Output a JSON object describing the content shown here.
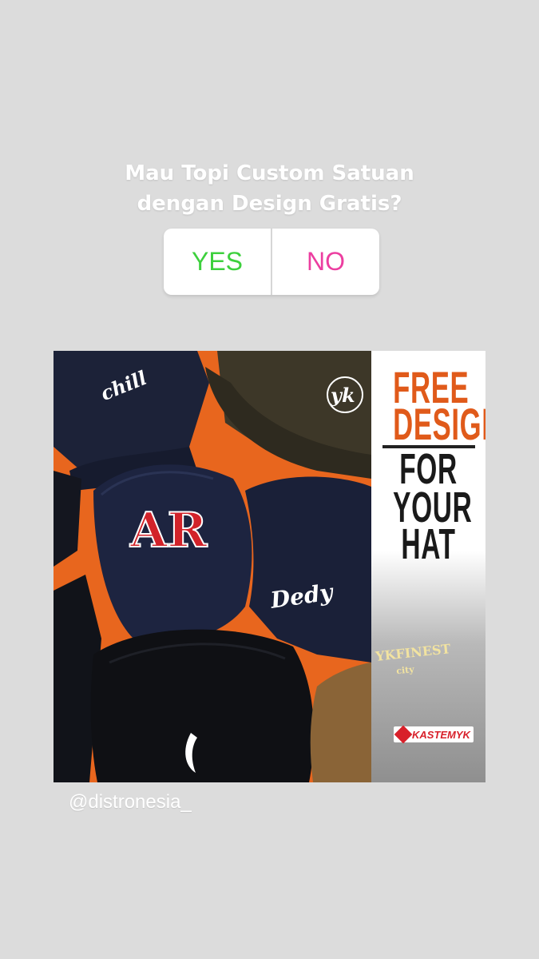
{
  "poll": {
    "question_line1": "Mau Topi Custom Satuan",
    "question_line2": "dengan Design Gratis?",
    "option_yes": "YES",
    "option_no": "NO",
    "colors": {
      "yes": "#3dd03d",
      "no": "#ec3ea0"
    }
  },
  "post": {
    "embroidery": {
      "hat1": "chill",
      "hat2": "yk",
      "hat3": "AR",
      "hat4": "Dedy"
    },
    "headline": {
      "line1": "FREE",
      "line2": "DESIGN",
      "line3": "FOR",
      "line4": "YOUR",
      "line5": "HAT"
    },
    "side_tag": "YKFINEST",
    "side_tag_sub": "city",
    "brand": "KASTEMYK",
    "colors": {
      "accent": "#e05a1a",
      "brand": "#d8202a"
    }
  },
  "mention": "@distronesia_"
}
